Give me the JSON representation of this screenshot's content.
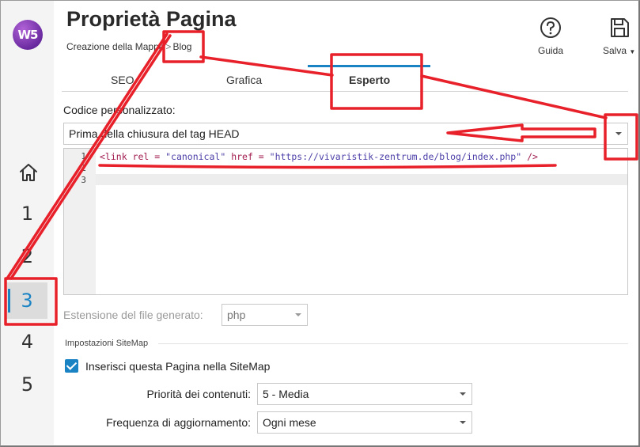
{
  "app": {
    "logo_text": "W5",
    "accent_color": "#1a83c4",
    "annotation_color": "#e8202a"
  },
  "header": {
    "title": "Proprietà Pagina",
    "breadcrumb": [
      "Creazione della Mappa",
      "Blog"
    ],
    "breadcrumb_sep": ">"
  },
  "toolbar": {
    "help_label": "Guida",
    "help_icon": "question-circle-icon",
    "save_label": "Salva",
    "save_icon": "floppy-disk-icon"
  },
  "steps": {
    "home_icon": "home-icon",
    "items": [
      "1",
      "2",
      "3",
      "4",
      "5"
    ],
    "active": "3"
  },
  "tabs": {
    "items": [
      "SEO",
      "Grafica",
      "Esperto"
    ],
    "active": "Esperto"
  },
  "custom_code": {
    "label": "Codice personalizzato:",
    "position_value": "Prima della chiusura del tag HEAD",
    "line_numbers": [
      "1",
      "2",
      "3"
    ],
    "code_line_1": {
      "open": "<link",
      "rel_attr": " rel = ",
      "rel_val": "\"canonical\"",
      "href_attr": " href = ",
      "href_val": "\"https://vivaristik-zentrum.de/blog/index.php\"",
      "close": " />"
    }
  },
  "file_extension": {
    "label": "Estensione del file generato:",
    "value": "php"
  },
  "sitemap": {
    "section_title": "Impostazioni SiteMap",
    "include_label": "Inserisci questa Pagina nella SiteMap",
    "include_checked": true,
    "priority_label": "Priorità dei contenuti:",
    "priority_value": "5 - Media",
    "frequency_label": "Frequenza di aggiornamento:",
    "frequency_value": "Ogni mese"
  }
}
